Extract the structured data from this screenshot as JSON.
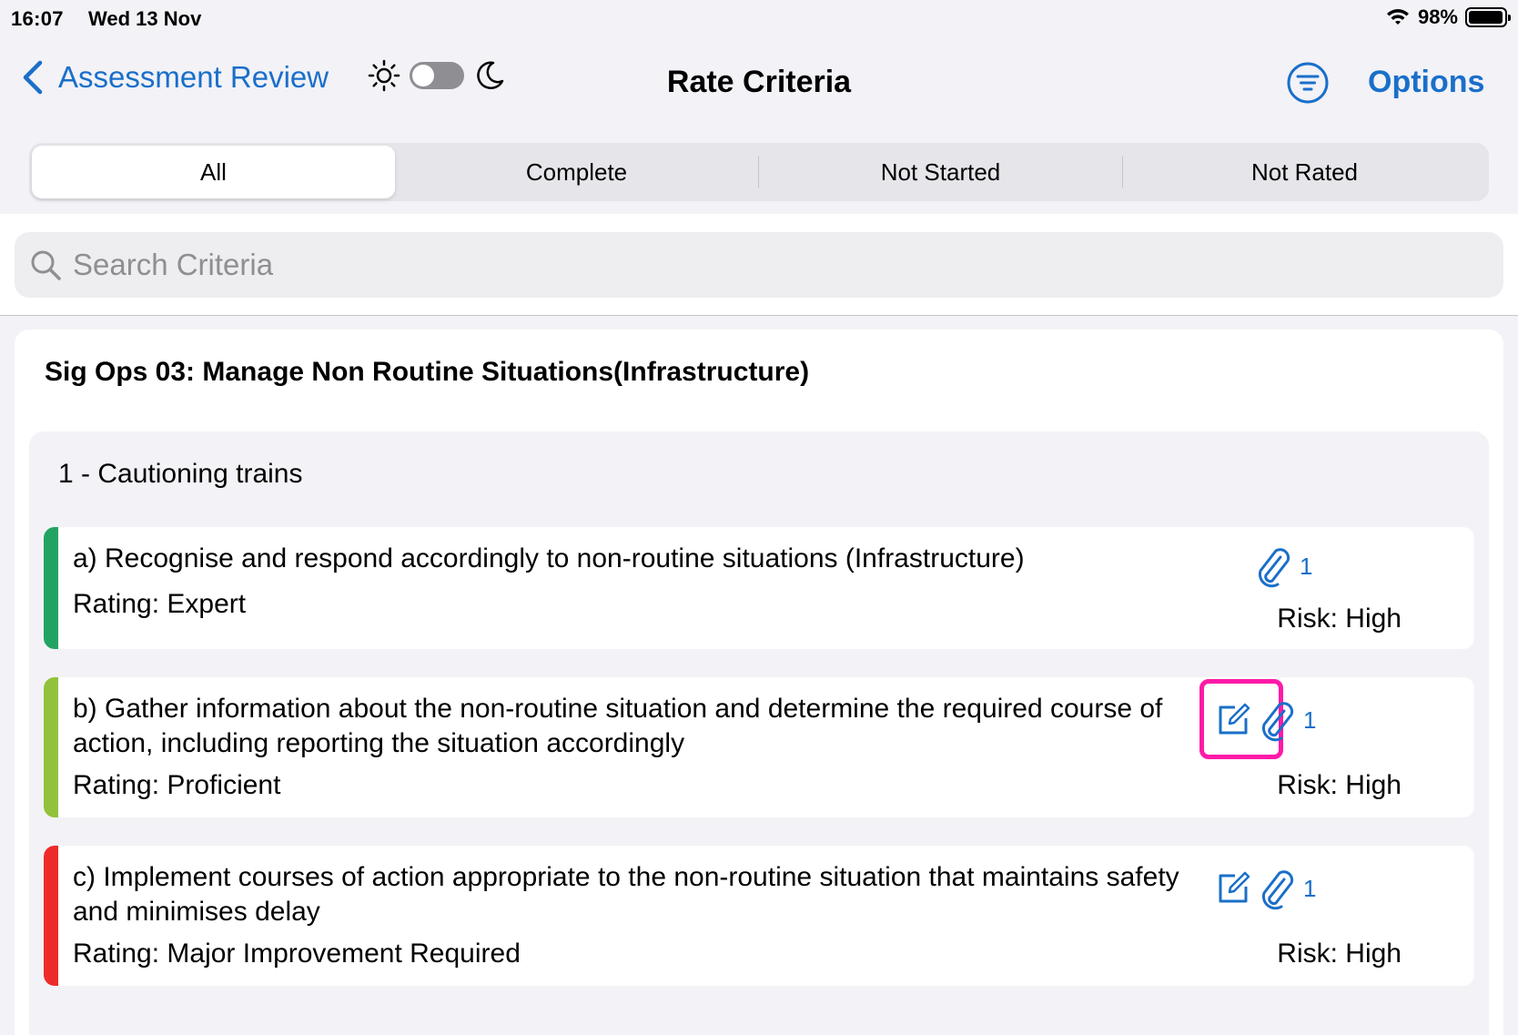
{
  "status_bar": {
    "time": "16:07",
    "date": "Wed 13 Nov",
    "battery_percent": "98%",
    "battery_level": 0.98
  },
  "nav": {
    "back_label": "Assessment Review",
    "title": "Rate Criteria",
    "options_label": "Options",
    "dark_mode_on": false
  },
  "segments": [
    {
      "label": "All",
      "active": true
    },
    {
      "label": "Complete",
      "active": false
    },
    {
      "label": "Not Started",
      "active": false
    },
    {
      "label": "Not Rated",
      "active": false
    }
  ],
  "search": {
    "placeholder": "Search Criteria",
    "value": ""
  },
  "group": {
    "title": "Sig Ops 03: Manage Non Routine Situations(Infrastructure)",
    "section": {
      "title": "1 - Cautioning trains",
      "criteria": [
        {
          "text": "a) Recognise and respond accordingly to non-routine situations (Infrastructure)",
          "rating": "Rating: Expert",
          "risk": "Risk: High",
          "attachments": "1",
          "has_edit": false,
          "color": "#22a363"
        },
        {
          "text": "b) Gather information about the non-routine situation and determine the required course of action, including reporting the situation accordingly",
          "rating": "Rating: Proficient",
          "risk": "Risk: High",
          "attachments": "1",
          "has_edit": true,
          "highlighted": true,
          "color": "#92c23b"
        },
        {
          "text": "c) Implement courses of action appropriate to the non-routine situation that maintains safety and minimises delay",
          "rating": "Rating: Major Improvement Required",
          "risk": "Risk: High",
          "attachments": "1",
          "has_edit": true,
          "color": "#ee2b2b"
        }
      ]
    }
  },
  "colors": {
    "accent": "#1a6fc9",
    "highlight": "#ff1aa8"
  }
}
